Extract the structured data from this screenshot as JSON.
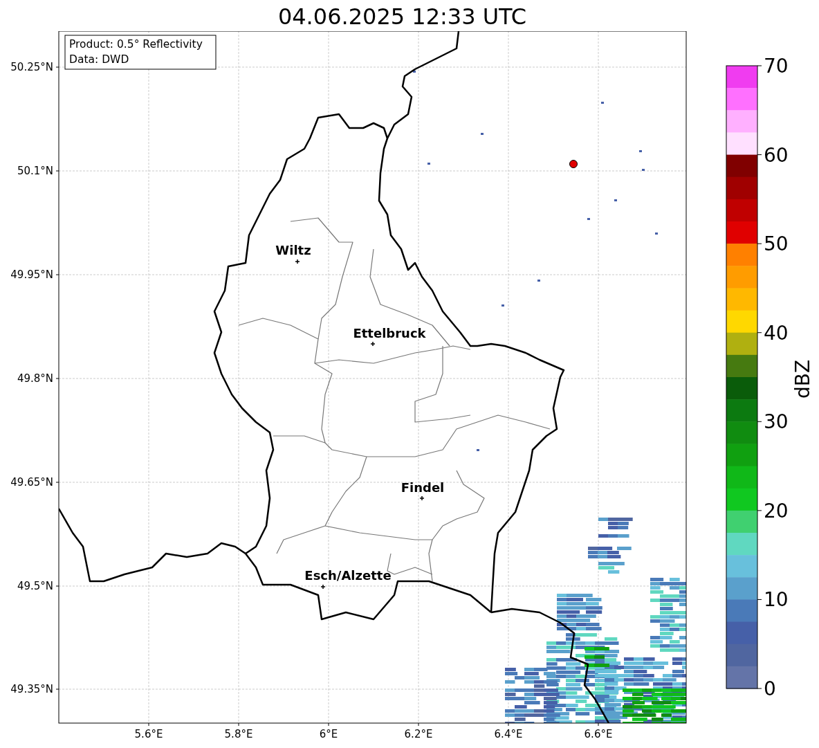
{
  "title": "04.06.2025 12:33 UTC",
  "legend": [
    "Product: 0.5° Reflectivity",
    "Data: DWD"
  ],
  "map": {
    "y_tick_labels": [
      "50.25°N",
      "50.1°N",
      "49.95°N",
      "49.8°N",
      "49.65°N",
      "49.5°N",
      "49.35°N"
    ],
    "x_tick_labels": [
      "5.6°E",
      "5.8°E",
      "6°E",
      "6.2°E",
      "6.4°E",
      "6.6°E"
    ],
    "cities": [
      "Wiltz",
      "Ettelbruck",
      "Findel",
      "Esch/Alzette"
    ]
  },
  "colorbar": {
    "label": "dBZ",
    "tick_labels": [
      "70",
      "60",
      "50",
      "40",
      "30",
      "20",
      "10",
      "0"
    ],
    "steps": [
      {
        "color": "#f03cf0"
      },
      {
        "color": "#ff70ff"
      },
      {
        "color": "#ffb0ff"
      },
      {
        "color": "#ffe0ff"
      },
      {
        "color": "#800000"
      },
      {
        "color": "#a00000"
      },
      {
        "color": "#c00000"
      },
      {
        "color": "#e00000"
      },
      {
        "color": "#ff8000"
      },
      {
        "color": "#ff9c00"
      },
      {
        "color": "#ffb800"
      },
      {
        "color": "#ffd800"
      },
      {
        "color": "#b0b010"
      },
      {
        "color": "#467a10"
      },
      {
        "color": "#0a5c0a"
      },
      {
        "color": "#0c7a10"
      },
      {
        "color": "#108c10"
      },
      {
        "color": "#10a010"
      },
      {
        "color": "#10b818"
      },
      {
        "color": "#10c820"
      },
      {
        "color": "#40d070"
      },
      {
        "color": "#60d8c0"
      },
      {
        "color": "#68c0dc"
      },
      {
        "color": "#5aa0cc"
      },
      {
        "color": "#4a7ab8"
      },
      {
        "color": "#4660a8"
      },
      {
        "color": "#5066a0"
      },
      {
        "color": "#6474a8"
      }
    ]
  }
}
